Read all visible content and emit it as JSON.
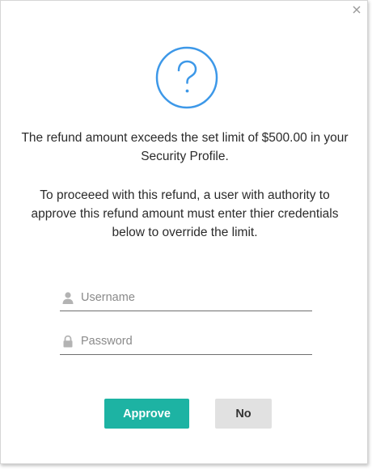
{
  "dialog": {
    "icon": "question-circle-icon",
    "accent_color": "#3d98e8",
    "message_primary": "The refund amount exceeds the set limit of $500.00 in your Security Profile.",
    "message_secondary": "To proceeed with this refund, a user with authority to approve this refund amount must enter thier credentials below to override the limit."
  },
  "form": {
    "username": {
      "placeholder": "Username",
      "value": "",
      "icon": "user-icon"
    },
    "password": {
      "placeholder": "Password",
      "value": "",
      "icon": "lock-icon"
    }
  },
  "actions": {
    "approve_label": "Approve",
    "approve_color": "#1db3a3",
    "no_label": "No",
    "no_color": "#e1e1e1"
  }
}
